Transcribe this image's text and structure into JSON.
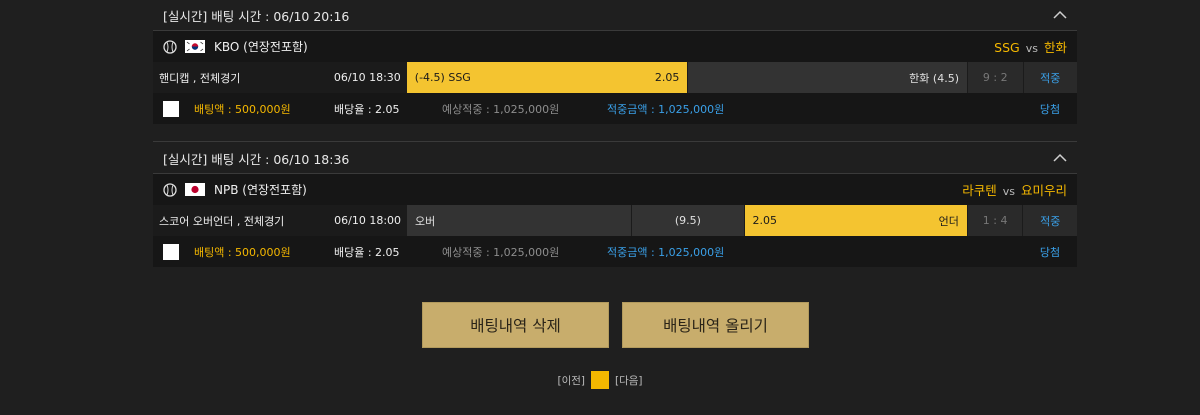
{
  "bets": [
    {
      "header": "[실시간] 배팅 시간 : 06/10 20:16",
      "league": "KBO (연장전포함)",
      "home": "SSG",
      "vs": "vs",
      "away": "한화",
      "market": "핸디캡 , 전체경기",
      "match_time": "06/10 18:30",
      "cells": [
        {
          "left": "(-4.5)  SSG",
          "right": "2.05",
          "selected": true
        },
        {
          "left": "",
          "right": "한화  (4.5)",
          "selected": false
        }
      ],
      "score": "9 : 2",
      "hit": "적중",
      "bet_amount": "배팅액 : 500,000원",
      "odds": "배당율 : 2.05",
      "expected": "예상적중 : 1,025,000원",
      "win_amount": "적중금액 : 1,025,000원",
      "result": "당첨",
      "flag": "kr"
    },
    {
      "header": "[실시간] 배팅 시간 : 06/10 18:36",
      "league": "NPB (연장전포함)",
      "home": "라쿠텐",
      "vs": "vs",
      "away": "요미우리",
      "market": "스코어 오버언더 , 전체경기",
      "match_time": "06/10 18:00",
      "cells": [
        {
          "left": "오버",
          "right": "",
          "selected": false
        },
        {
          "left": "",
          "right": "(9.5)",
          "selected": false,
          "center": true
        },
        {
          "left": "2.05",
          "right": "언더",
          "selected": true
        }
      ],
      "score": "1 : 4",
      "hit": "적중",
      "bet_amount": "배팅액 : 500,000원",
      "odds": "배당율 : 2.05",
      "expected": "예상적중 : 1,025,000원",
      "win_amount": "적중금액 : 1,025,000원",
      "result": "당첨",
      "flag": "jp"
    }
  ],
  "buttons": {
    "delete": "배팅내역 삭제",
    "upload": "배팅내역 올리기"
  },
  "pager": {
    "prev": "[이전]",
    "next": "[다음]"
  },
  "colors": {
    "accent": "#f5b800",
    "selected_cell": "#f4c430",
    "blue": "#3aa0e8",
    "button": "#c8ad6c"
  }
}
